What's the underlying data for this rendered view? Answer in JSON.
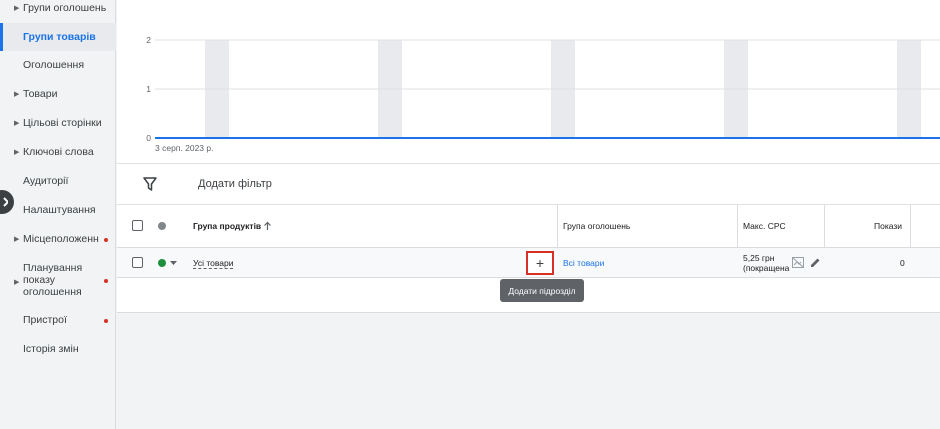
{
  "sidebar": {
    "items": [
      {
        "label": "Групи оголошень",
        "arrow": true,
        "dot": false,
        "active": false
      },
      {
        "label": "Групи товарів",
        "arrow": false,
        "dot": false,
        "active": true
      },
      {
        "label": "Оголошення",
        "arrow": false,
        "dot": false,
        "active": false
      },
      {
        "label": "Товари",
        "arrow": true,
        "dot": false,
        "active": false
      },
      {
        "label": "Цільові сторінки",
        "arrow": true,
        "dot": false,
        "active": false
      },
      {
        "label": "Ключові слова",
        "arrow": true,
        "dot": false,
        "active": false
      },
      {
        "label": "Аудиторії",
        "arrow": false,
        "dot": false,
        "active": false
      },
      {
        "label": "Налаштування",
        "arrow": false,
        "dot": false,
        "active": false
      },
      {
        "label": "Місцеположення",
        "arrow": true,
        "dot": true,
        "active": false
      },
      {
        "label_lines": [
          "Планування",
          "показу",
          "оголошення"
        ],
        "arrow": true,
        "dot": true,
        "active": false
      },
      {
        "label": "Пристрої",
        "arrow": false,
        "dot": true,
        "active": false
      },
      {
        "label": "Історія змін",
        "arrow": false,
        "dot": false,
        "active": false
      }
    ],
    "collapse_icon": "chevron-right-icon"
  },
  "chart_data": {
    "type": "line",
    "y_ticks": [
      "2",
      "1",
      "0"
    ],
    "ylim": [
      0,
      2
    ],
    "x_label_first": "3 серп. 2023 р.",
    "series": [
      {
        "values": [
          0,
          0,
          0,
          0,
          0,
          0,
          0,
          0,
          0,
          0,
          0,
          0,
          0,
          0,
          0,
          0,
          0,
          0,
          0,
          0,
          0,
          0,
          0,
          0,
          0,
          0,
          0,
          0,
          0,
          0,
          0
        ]
      }
    ],
    "weekend_bands": 6,
    "line_color": "#1a73e8",
    "grid": true
  },
  "filter": {
    "icon": "filter-icon",
    "label": "Додати фільтр"
  },
  "table": {
    "columns": {
      "product_group": "Група продуктів",
      "ad_group": "Група оголошень",
      "max_cpc": "Макс. CPC",
      "impressions": "Покази"
    },
    "rows": [
      {
        "status_color": "#1e8e3e",
        "product_group": "Усі товари",
        "ad_group": "Всі товари",
        "max_cpc_line1": "5,25 грн",
        "max_cpc_line2": "(покращена",
        "impressions": "0"
      }
    ]
  },
  "tooltip": {
    "text": "Додати підрозділ"
  },
  "add_button": {
    "label": "+"
  }
}
